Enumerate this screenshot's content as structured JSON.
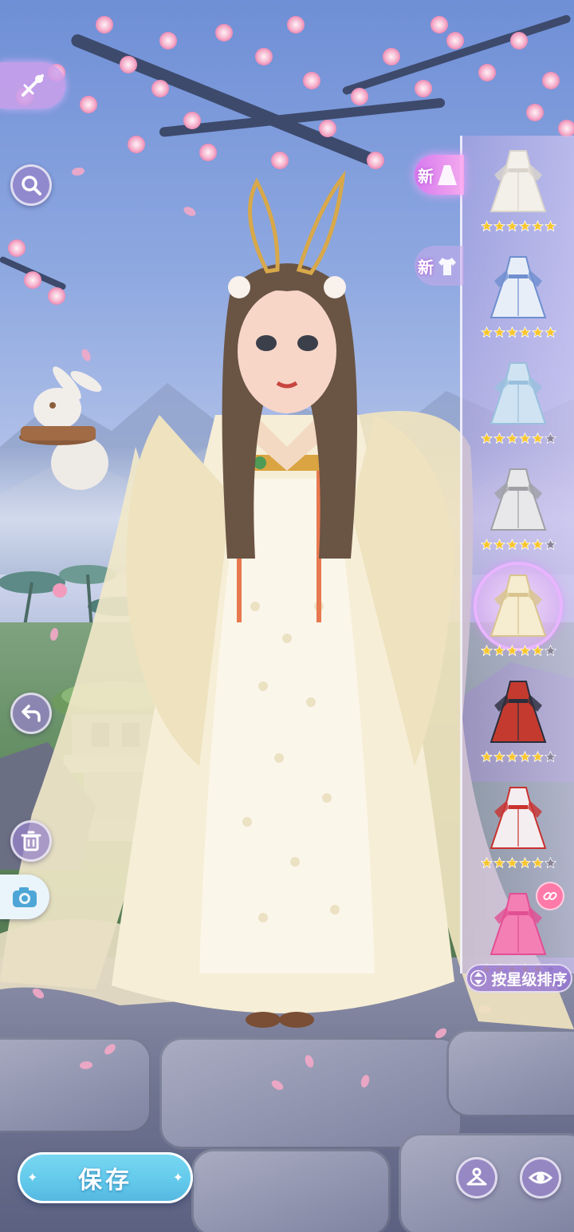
{
  "toolbar": {
    "filter_icon": "hairpin-filter-icon",
    "search_icon": "search-icon",
    "undo_icon": "undo-icon",
    "delete_icon": "trash-icon",
    "camera_icon": "camera-icon"
  },
  "categories": [
    {
      "new_badge": "新",
      "active": true,
      "icon": "dress-icon"
    },
    {
      "new_badge": "新",
      "active": false,
      "icon": "top-icon"
    }
  ],
  "items": [
    {
      "name": "white-cape-gown",
      "stars": 6,
      "max_stars": 6,
      "colors": [
        "#f3f0ea",
        "#d9d4cc"
      ]
    },
    {
      "name": "blue-white-qipao",
      "stars": 6,
      "max_stars": 6,
      "colors": [
        "#e8eef8",
        "#6f8fcf"
      ]
    },
    {
      "name": "lightblue-hanfu",
      "stars": 5,
      "max_stars": 6,
      "colors": [
        "#cfe3f2",
        "#9ac0dd"
      ]
    },
    {
      "name": "grey-white-robe",
      "stars": 5,
      "max_stars": 6,
      "colors": [
        "#e8e8ea",
        "#9fa0a6"
      ]
    },
    {
      "name": "cream-moon-hanfu",
      "stars": 5,
      "max_stars": 6,
      "colors": [
        "#f6ecd0",
        "#d9c48f"
      ],
      "selected": true
    },
    {
      "name": "red-warrior-outfit",
      "stars": 5,
      "max_stars": 6,
      "colors": [
        "#c53a2e",
        "#2a2d3c"
      ]
    },
    {
      "name": "red-white-dress",
      "stars": 5,
      "max_stars": 6,
      "colors": [
        "#f4eef0",
        "#c9322f"
      ]
    },
    {
      "name": "pink-layered-gown",
      "stars": 5,
      "max_stars": 6,
      "colors": [
        "#f47fb4",
        "#e24f94"
      ],
      "linked": true
    }
  ],
  "sort": {
    "label": "按星级排序",
    "icon": "sort-arrows-icon"
  },
  "save": {
    "label": "保存"
  },
  "bottom_right": {
    "wardrobe_icon": "hanger-icon",
    "preview_icon": "eye-icon"
  },
  "colors": {
    "accent": "#61c8ea",
    "panel": "#b9a6e6",
    "star": "#f7c62f",
    "star_empty": "#8a8499"
  }
}
